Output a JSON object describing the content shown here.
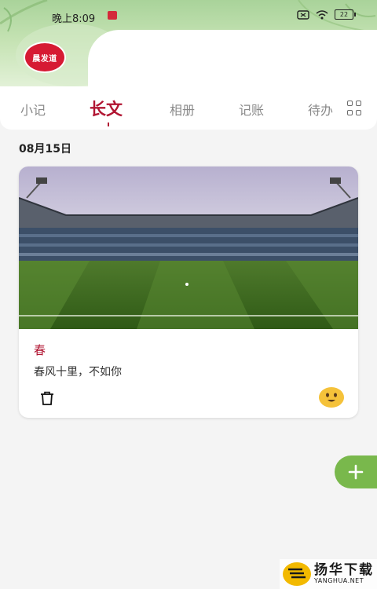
{
  "status_bar": {
    "time": "晚上8:09",
    "battery": "22"
  },
  "app": {
    "avatar_text": "晨发道"
  },
  "tabs": [
    {
      "label": "小记",
      "active": false
    },
    {
      "label": "长文",
      "active": true
    },
    {
      "label": "相册",
      "active": false
    },
    {
      "label": "记账",
      "active": false
    },
    {
      "label": "待办",
      "active": false
    }
  ],
  "section": {
    "date": "08月15日"
  },
  "card": {
    "image_icon": "stadium-photo",
    "title": "春",
    "body": "春风十里，不如你",
    "delete_icon": "trash-icon",
    "mood_icon": "smile-emoji-icon"
  },
  "fab": {
    "icon": "plus-icon"
  },
  "watermark": {
    "cn": "扬华下载",
    "en": "YANGHUA.NET"
  },
  "colors": {
    "accent": "#b11532",
    "fab": "#79b84c",
    "header_green": "#a9d39a"
  }
}
